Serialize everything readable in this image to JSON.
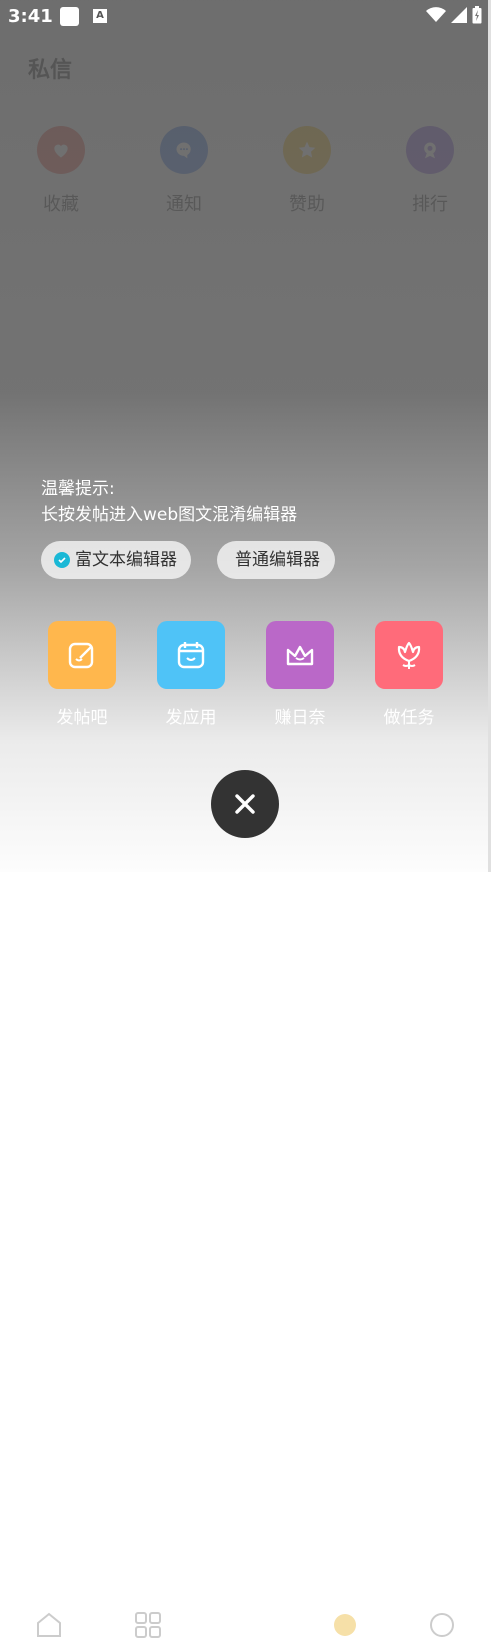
{
  "status_bar": {
    "time": "3:41",
    "a_icon": "A"
  },
  "page": {
    "title": "私信"
  },
  "quick_actions": [
    {
      "label": "收藏",
      "icon": "heart-icon",
      "color": "#e74c3c"
    },
    {
      "label": "通知",
      "icon": "chat-icon",
      "color": "#2f6fe8"
    },
    {
      "label": "赞助",
      "icon": "star-icon",
      "color": "#f5b800"
    },
    {
      "label": "排行",
      "icon": "medal-icon",
      "color": "#7c4ddb"
    }
  ],
  "publish_panel": {
    "tip_title": "温馨提示:",
    "tip_text": "长按发帖进入web图文混淆编辑器",
    "editor_modes": [
      {
        "label": "富文本编辑器",
        "selected": true
      },
      {
        "label": "普通编辑器",
        "selected": false
      }
    ],
    "actions": [
      {
        "label": "发帖吧",
        "icon": "edit-icon",
        "color": "#ffb74d"
      },
      {
        "label": "发应用",
        "icon": "calendar-icon",
        "color": "#4fc3f7"
      },
      {
        "label": "赚日奈",
        "icon": "crown-icon",
        "color": "#ba68c8"
      },
      {
        "label": "做任务",
        "icon": "flower-icon",
        "color": "#ff6b7a"
      }
    ]
  }
}
